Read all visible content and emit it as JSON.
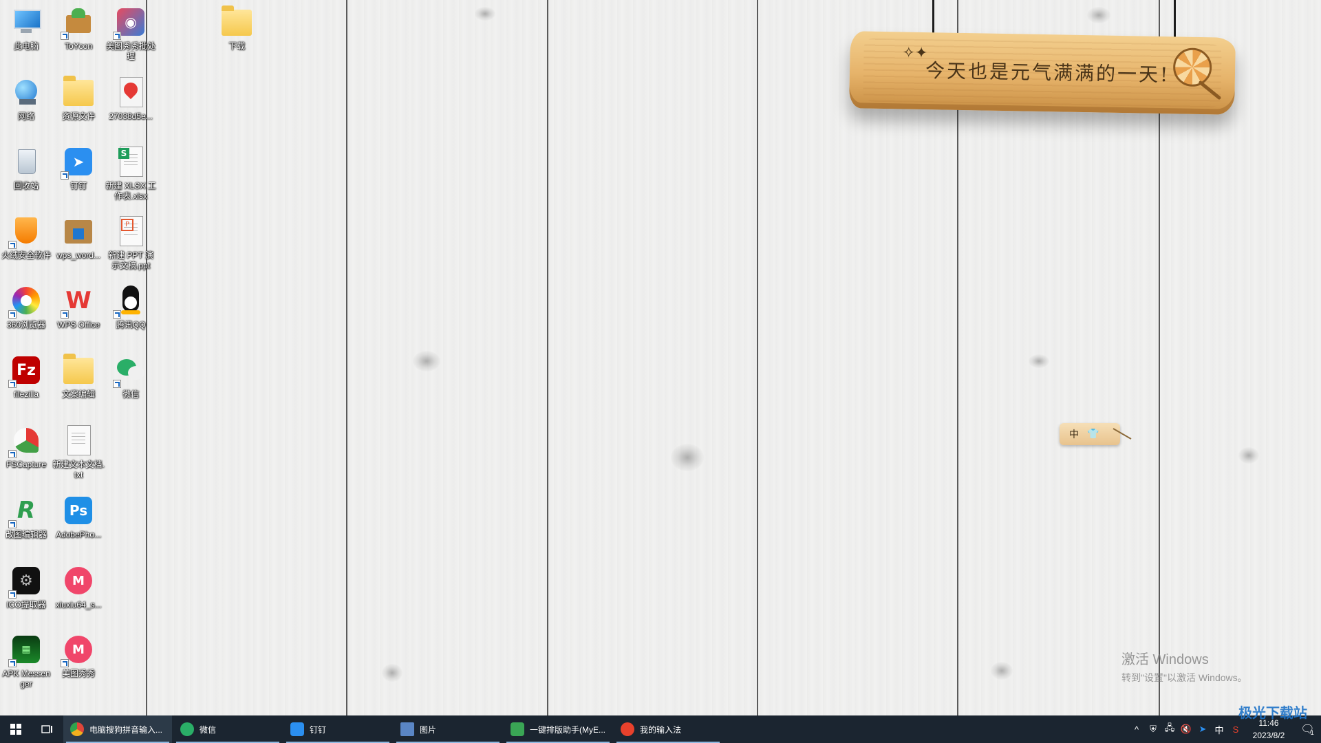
{
  "desktop_icons": [
    {
      "label": "此电脑",
      "icon": "computer-icon",
      "shortcut": false
    },
    {
      "label": "ToYcon",
      "icon": "toycon-box-icon",
      "shortcut": true
    },
    {
      "label": "美图秀秀批处理",
      "icon": "meitu-batch-icon",
      "shortcut": true
    },
    {
      "label": "下载",
      "icon": "folder-icon",
      "shortcut": false
    },
    {
      "label": "网络",
      "icon": "network-globe-icon",
      "shortcut": false
    },
    {
      "label": "资源文件",
      "icon": "folder-icon",
      "shortcut": false
    },
    {
      "label": "27038d5e...",
      "icon": "image-file-icon",
      "shortcut": false
    },
    {
      "label": "回收站",
      "icon": "recycle-bin-icon",
      "shortcut": false
    },
    {
      "label": "钉钉",
      "icon": "dingtalk-icon",
      "shortcut": true
    },
    {
      "label": "新建 XLSX 工作表.xlsx",
      "icon": "xlsx-file-icon",
      "shortcut": false
    },
    {
      "label": "火绒安全软件",
      "icon": "huorong-icon",
      "shortcut": true
    },
    {
      "label": "wps_word...",
      "icon": "installer-box-icon",
      "shortcut": false
    },
    {
      "label": "新建 PPT 演示文稿.ppt",
      "icon": "ppt-file-icon",
      "shortcut": false
    },
    {
      "label": "360浏览器",
      "icon": "browser-360-icon",
      "shortcut": true
    },
    {
      "label": "WPS Office",
      "icon": "wps-office-icon",
      "shortcut": true
    },
    {
      "label": "腾讯QQ",
      "icon": "qq-penguin-icon",
      "shortcut": true
    },
    {
      "label": "filezilla",
      "icon": "filezilla-icon",
      "shortcut": true
    },
    {
      "label": "文案编辑",
      "icon": "folder-icon",
      "shortcut": false
    },
    {
      "label": "微信",
      "icon": "wechat-icon",
      "shortcut": true
    },
    {
      "label": "FSCapture",
      "icon": "fscapture-icon",
      "shortcut": true
    },
    {
      "label": "新建文本文档.txt",
      "icon": "txt-file-icon",
      "shortcut": false
    },
    {
      "label": "改图编辑器",
      "icon": "editor-r-icon",
      "shortcut": true
    },
    {
      "label": "AdobePho...",
      "icon": "photoshop-icon",
      "shortcut": false
    },
    {
      "label": "ICO提取器",
      "icon": "ico-extractor-icon",
      "shortcut": true
    },
    {
      "label": "xiuxiu64_s...",
      "icon": "meitu-installer-icon",
      "shortcut": false
    },
    {
      "label": "APK Messenger",
      "icon": "apk-messenger-icon",
      "shortcut": true
    },
    {
      "label": "美图秀秀",
      "icon": "meitu-icon",
      "shortcut": true
    }
  ],
  "wallpaper": {
    "sign_text": "今天也是元气满满的一天!",
    "colors": {
      "plank": "#f1f1f0",
      "seam": "#3f3f3f",
      "sign_wood": "#e6b36a",
      "sign_ink": "#4a3418"
    }
  },
  "ime_bar": {
    "mode": "中",
    "skin_icon": "tshirt-icon"
  },
  "watermark": {
    "line1": "激活 Windows",
    "line2": "转到\"设置\"以激活 Windows。"
  },
  "taskbar": {
    "apps": [
      {
        "label": "电脑搜狗拼音输入...",
        "icon": "chrome-icon",
        "color": "#e0463a"
      },
      {
        "label": "微信",
        "icon": "wechat-icon",
        "color": "#2aae67"
      },
      {
        "label": "钉钉",
        "icon": "dingtalk-icon",
        "color": "#2b8ff0"
      },
      {
        "label": "图片",
        "icon": "photos-icon",
        "color": "#5a86c5"
      },
      {
        "label": "一键排版助手(MyE...",
        "icon": "editor-r-icon",
        "color": "#3aa655"
      },
      {
        "label": "我的输入法",
        "icon": "sogou-icon",
        "color": "#e8412c"
      }
    ],
    "tray": {
      "chevron": "^",
      "ime_mode": "中",
      "time": "11:46",
      "date": "2023/8/2",
      "notification_count": "1"
    }
  },
  "site_watermark": "极光下载站"
}
